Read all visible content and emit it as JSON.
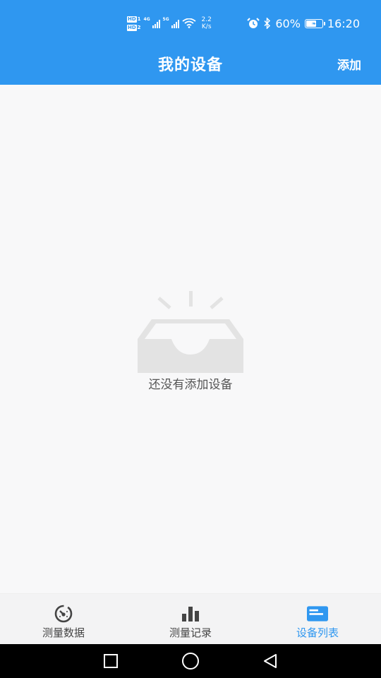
{
  "status_bar": {
    "sim1": "HD",
    "sim1_num": "1",
    "sim2": "HD",
    "sim2_num": "2",
    "net1": "4G",
    "net2": "5G",
    "speed_value": "2.2",
    "speed_unit": "K/s",
    "battery": "60%",
    "time": "16:20",
    "icons": [
      "alarm-icon",
      "bluetooth-icon",
      "battery-saver-icon",
      "wifi-icon",
      "signal-icon"
    ]
  },
  "header": {
    "title": "我的设备",
    "add_label": "添加"
  },
  "empty_state": {
    "message": "还没有添加设备",
    "icon": "empty-inbox-icon"
  },
  "tabs": [
    {
      "label": "测量数据",
      "icon": "gauge-icon",
      "active": false
    },
    {
      "label": "测量记录",
      "icon": "bar-chart-icon",
      "active": false
    },
    {
      "label": "设备列表",
      "icon": "device-list-icon",
      "active": true
    }
  ],
  "colors": {
    "primary": "#2f97f0",
    "background": "#f8f8f9",
    "tab_inactive": "#444444"
  }
}
